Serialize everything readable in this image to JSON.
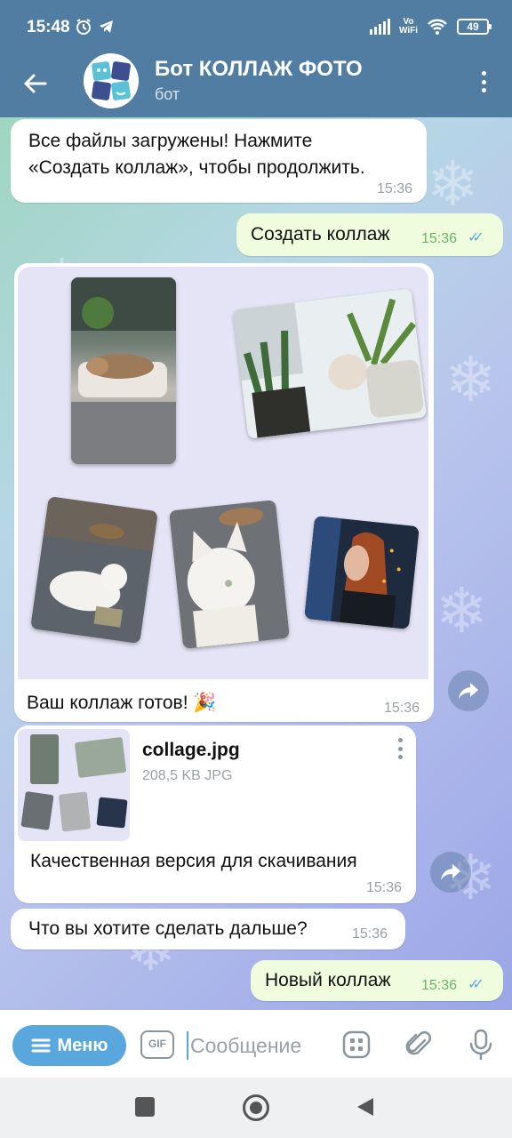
{
  "status_bar": {
    "time": "15:48",
    "battery": "49",
    "vowifi": [
      "Vo",
      "WiFi"
    ]
  },
  "header": {
    "title": "Бот КОЛЛАЖ ФОТО",
    "subtitle": "бот"
  },
  "messages": [
    {
      "direction": "in",
      "text_lines": [
        "Все файлы загружены! Нажмите",
        "«Создать коллаж», чтобы продолжить."
      ],
      "time": "15:36"
    },
    {
      "direction": "out",
      "text": "Создать коллаж",
      "time": "15:36",
      "read": true
    },
    {
      "direction": "in",
      "type": "photo",
      "caption": "Ваш коллаж готов! 🎉",
      "time": "15:36"
    },
    {
      "direction": "in",
      "type": "file",
      "file_name": "collage.jpg",
      "file_meta": "208,5 KB JPG",
      "caption": "Качественная версия для скачивания",
      "time": "15:36"
    },
    {
      "direction": "in",
      "text": "Что вы хотите сделать дальше?",
      "time": "15:36"
    },
    {
      "direction": "out",
      "text": "Новый коллаж",
      "time": "15:36",
      "read": true
    }
  ],
  "input_bar": {
    "menu_label": "Меню",
    "gif_label": "GIF",
    "placeholder": "Сообщение"
  },
  "colors": {
    "header": "#517da2",
    "menu_button": "#5aa7de",
    "outgoing_bubble": "#effdde",
    "read_checks": "#5fa8d8"
  },
  "icons": [
    "back-arrow-icon",
    "more-vert-icon",
    "forward-icon",
    "emoji-keyboard-icon",
    "attach-icon",
    "microphone-icon",
    "nav-square-icon",
    "nav-home-icon",
    "nav-back-icon"
  ]
}
